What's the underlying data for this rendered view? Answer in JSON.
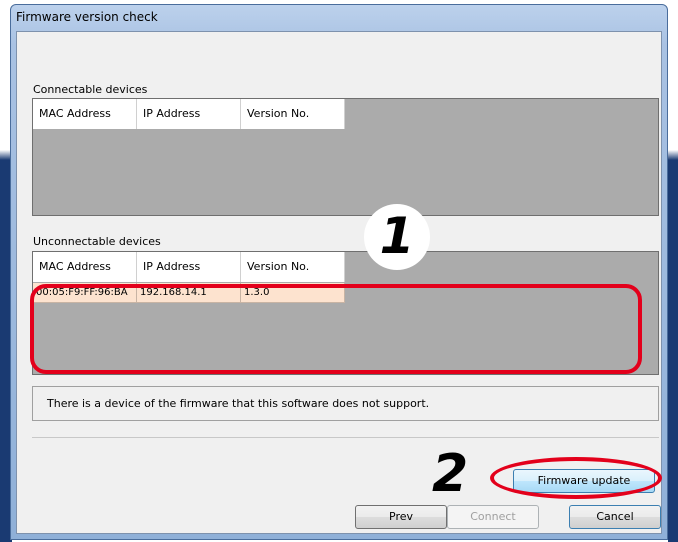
{
  "window": {
    "title": "Firmware version check"
  },
  "connectable": {
    "label": "Connectable devices",
    "columns": [
      "MAC Address",
      "IP Address",
      "Version No."
    ],
    "rows": []
  },
  "unconnectable": {
    "label": "Unconnectable devices",
    "columns": [
      "MAC Address",
      "IP Address",
      "Version No."
    ],
    "rows": [
      {
        "mac": "00:05:F9:FF:96:BA",
        "ip": "192.168.14.1",
        "version": "1.3.0"
      }
    ]
  },
  "message": "There is a device of the firmware that this software does not support.",
  "buttons": {
    "firmware_update": "Firmware update",
    "prev": "Prev",
    "connect": "Connect",
    "cancel": "Cancel"
  },
  "annotations": {
    "marker1": "1",
    "marker2": "2"
  },
  "colors": {
    "highlight": "#e3001b",
    "row_bg": "#fde3cf",
    "grid_bg": "#ababab"
  }
}
